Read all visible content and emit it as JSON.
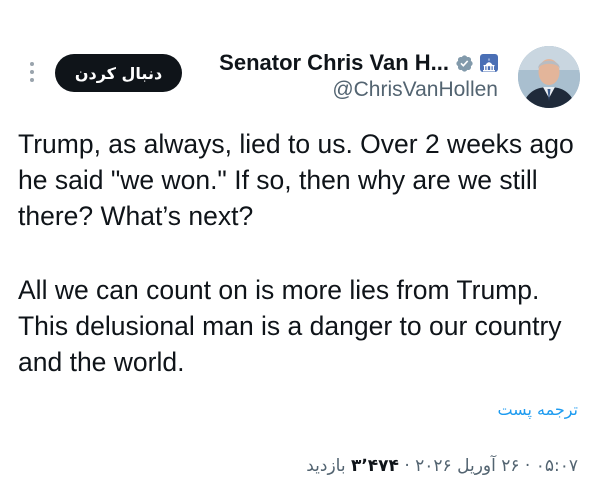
{
  "header": {
    "follow_label": "دنبال کردن",
    "display_name": "Senator Chris Van H...",
    "handle": "@ChrisVanHollen"
  },
  "tweet": {
    "paragraphs": [
      "Trump, as always, lied to us. Over 2 weeks ago he said \"we won.\" If so, then why are we still there? What’s next?",
      "All we can count on is more lies from Trump. This delusional man is a danger to our country and the world."
    ],
    "translate_label": "ترجمه پست"
  },
  "meta": {
    "time": "۰۵:۰۷",
    "separator": " · ",
    "date": "۲۶ آوریل ۲۰۲۶",
    "views_count": "۳٬۴۷۴",
    "views_label": " بازدید"
  },
  "colors": {
    "text": "#0f1419",
    "secondary": "#536471",
    "link": "#1d9bf0",
    "follow_bg": "#0f1419",
    "verified": "#829aab",
    "affiliate_badge": "#4a6fb5"
  },
  "icons": [
    "more-vertical-icon",
    "verified-badge-icon",
    "capitol-icon",
    "avatar"
  ]
}
